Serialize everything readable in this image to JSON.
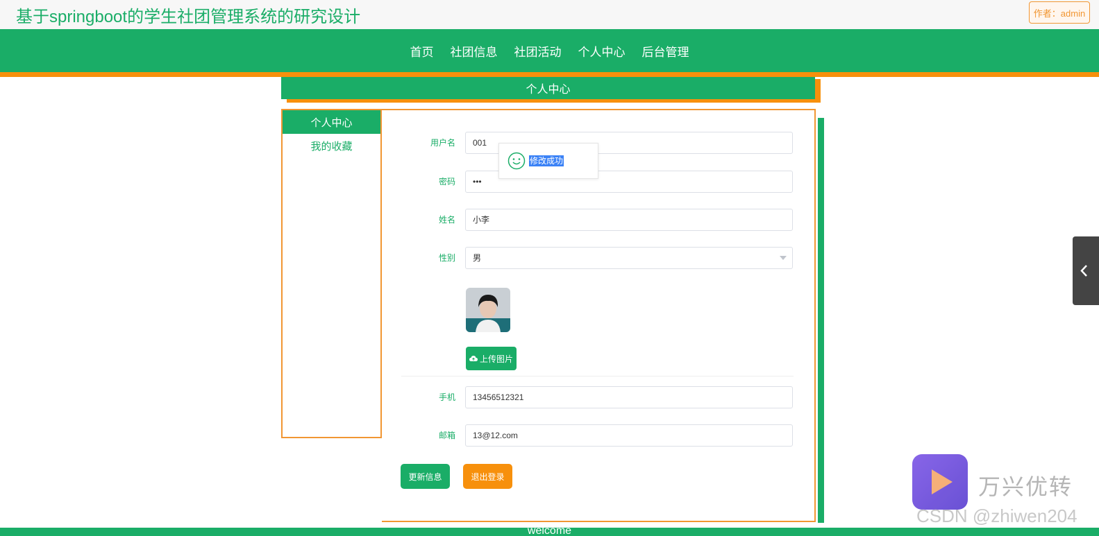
{
  "header": {
    "site_title": "基于springboot的学生社团管理系统的研究设计",
    "author_label": "作者：admin"
  },
  "nav": {
    "items": [
      "首页",
      "社团信息",
      "社团活动",
      "个人中心",
      "后台管理"
    ]
  },
  "section": {
    "title": "个人中心"
  },
  "sidebar": {
    "items": [
      {
        "label": "个人中心",
        "active": true
      },
      {
        "label": "我的收藏",
        "active": false
      }
    ]
  },
  "form": {
    "username": {
      "label": "用户名",
      "value": "001"
    },
    "password": {
      "label": "密码",
      "value": "•••"
    },
    "name": {
      "label": "姓名",
      "value": "小李"
    },
    "gender": {
      "label": "性别",
      "value": "男"
    },
    "upload_label": "上传图片",
    "phone": {
      "label": "手机",
      "value": "13456512321"
    },
    "email": {
      "label": "邮箱",
      "value": "13@12.com"
    },
    "update_label": "更新信息",
    "logout_label": "退出登录"
  },
  "toast": {
    "message": "修改成功",
    "icon": "smile-icon"
  },
  "footer": {
    "text": "welcome"
  },
  "watermark": {
    "brand": "万兴优转",
    "csdn": "CSDN @zhiwen204"
  },
  "colors": {
    "primary": "#1aad67",
    "accent": "#f7900c",
    "label": "#1aad67"
  }
}
